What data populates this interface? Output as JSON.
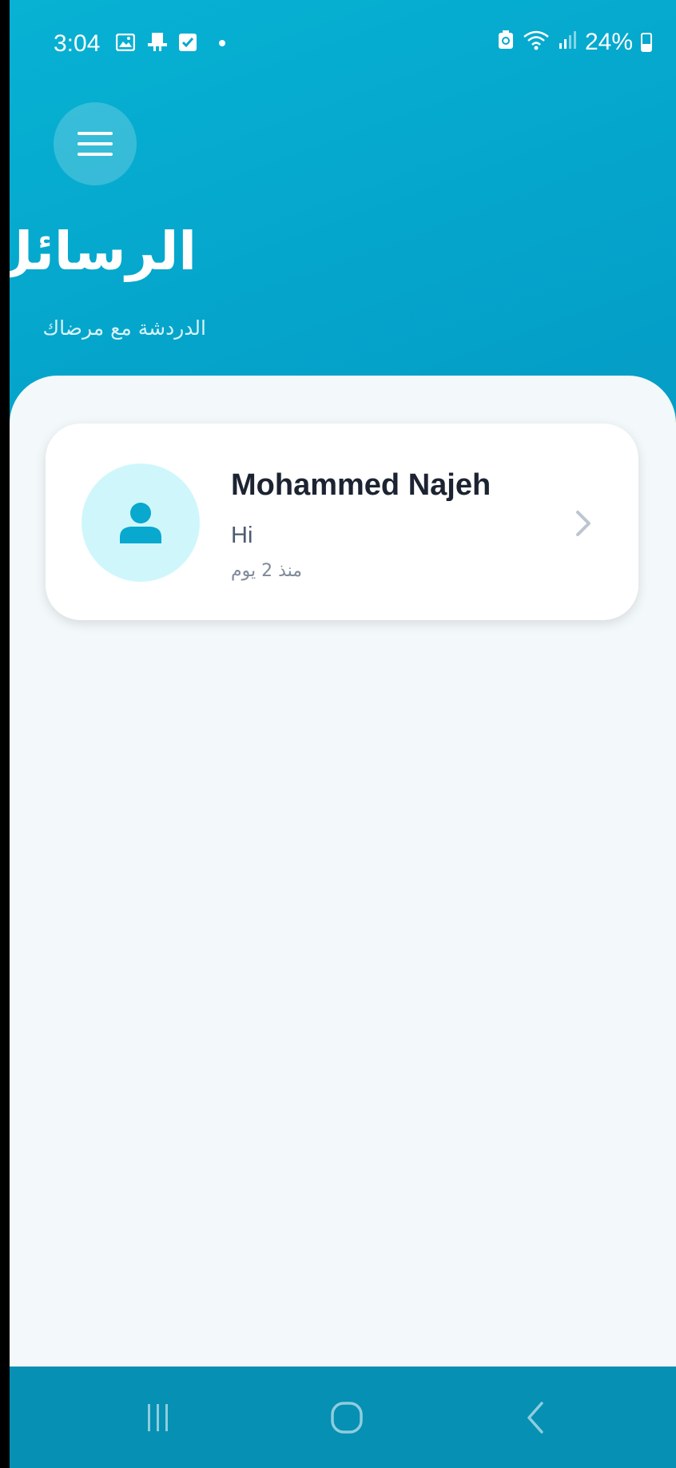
{
  "status_bar": {
    "time": "3:04",
    "battery_percent": "24%",
    "icons": [
      "gallery-icon",
      "sim-icon",
      "checkbox-icon",
      "dot-icon",
      "battery-saver-icon",
      "wifi-icon",
      "signal-icon",
      "battery-icon"
    ]
  },
  "header": {
    "title": "الرسائل",
    "subtitle": "الدردشة مع مرضاك",
    "menu_icon": "hamburger-menu-icon"
  },
  "conversations": [
    {
      "name": "Mohammed Najeh",
      "last_message": "Hi",
      "time_ago": "منذ 2 يوم",
      "avatar_icon": "person-icon"
    }
  ],
  "nav_bar": {
    "buttons": [
      "recent-apps-icon",
      "home-icon",
      "back-icon"
    ]
  },
  "colors": {
    "header_gradient_start": "#07b2d3",
    "header_gradient_end": "#0a93ad",
    "content_bg": "#f3f8fa",
    "card_bg": "#ffffff",
    "avatar_bg": "#cff7fb",
    "avatar_icon": "#08a8cf",
    "name_text": "#1c2331"
  }
}
